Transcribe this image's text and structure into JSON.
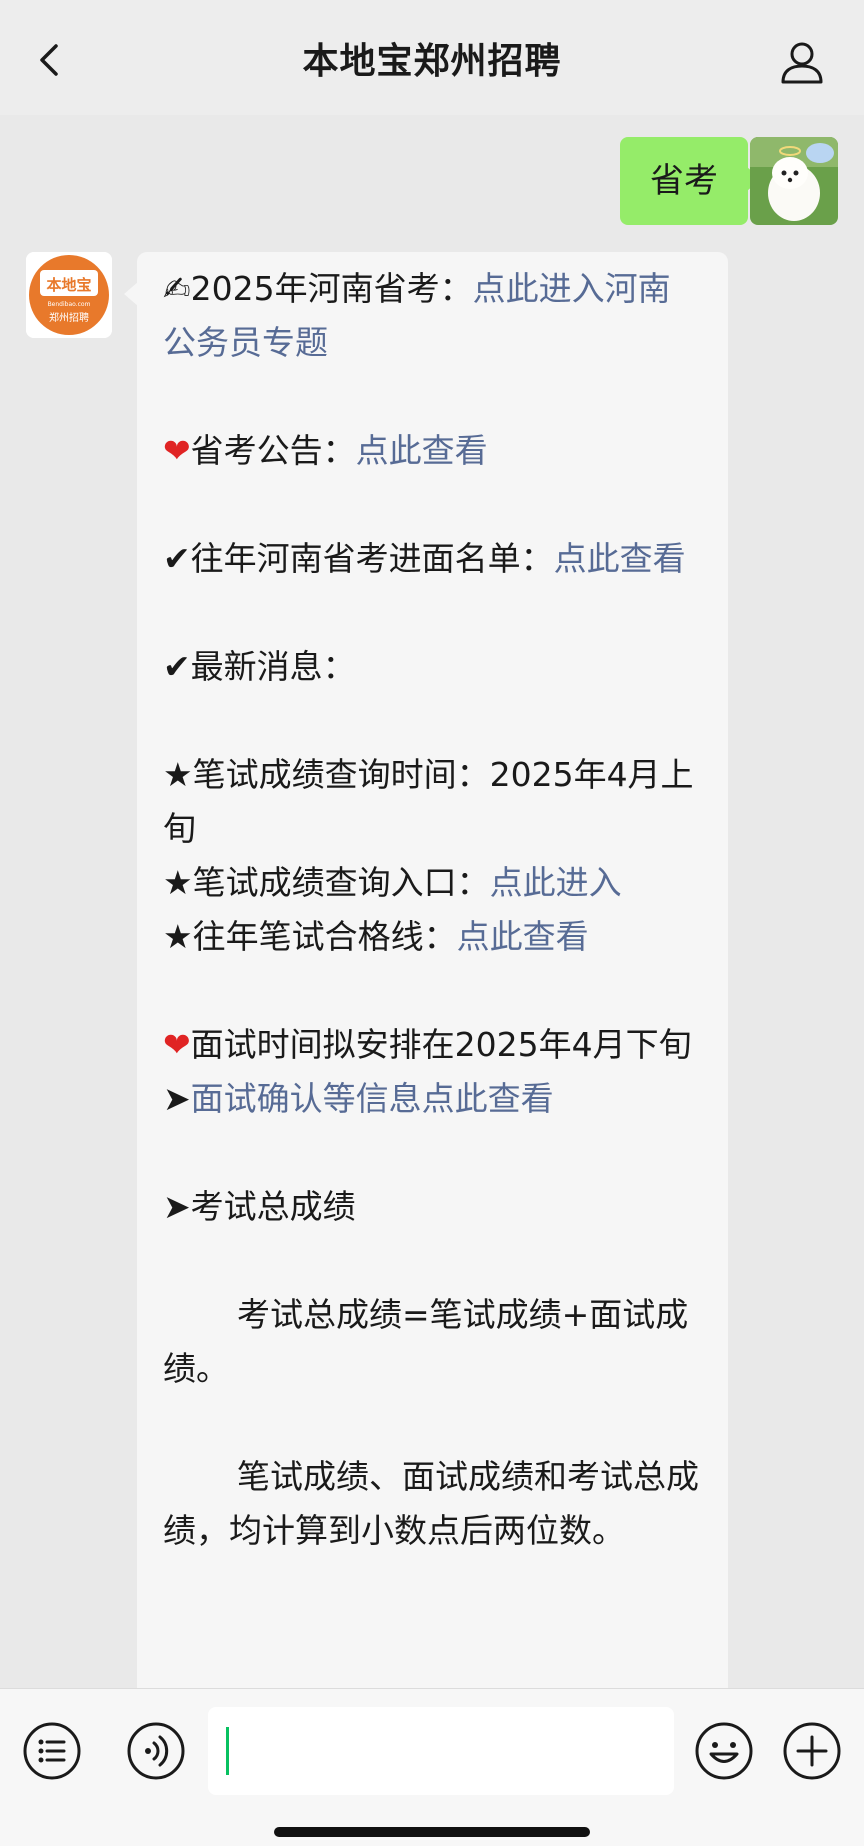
{
  "header": {
    "title": "本地宝郑州招聘",
    "back_icon": "chevron-left-icon",
    "profile_icon": "person-icon"
  },
  "outgoing": {
    "text": "省考",
    "bubble_color": "#95ec69"
  },
  "bot": {
    "avatar": {
      "brand_text": "本地宝",
      "domain_text": "Bendibao.com",
      "sub_text": "郑州招聘",
      "brand_color": "#e8792b"
    },
    "lines": {
      "l1_prefix": "2025年河南省考：",
      "l1_link": "点此进入河南公务员专题",
      "l2_prefix": "省考公告：",
      "l2_link": "点此查看",
      "l3_prefix": "往年河南省考进面名单：",
      "l3_link": "点此查看",
      "l4": "最新消息：",
      "l5": "★笔试成绩查询时间：2025年4月上旬",
      "l6_prefix": "★笔试成绩查询入口：",
      "l6_link": "点此进入",
      "l7_prefix": "★往年笔试合格线：",
      "l7_link": "点此查看",
      "l8": "面试时间拟安排在2025年4月下旬",
      "l9_link": "面试确认等信息点此查看",
      "l10": "考试总成绩",
      "l11": "考试总成绩=笔试成绩+面试成绩。",
      "l12": "笔试成绩、面试成绩和考试总成绩，均计算到小数点后两位数。"
    },
    "link_color": "#576b95"
  },
  "toolbar": {
    "menu_icon": "list-icon",
    "voice_icon": "voice-icon",
    "emoji_icon": "smiley-icon",
    "plus_icon": "plus-icon",
    "accent": "#07c160"
  }
}
